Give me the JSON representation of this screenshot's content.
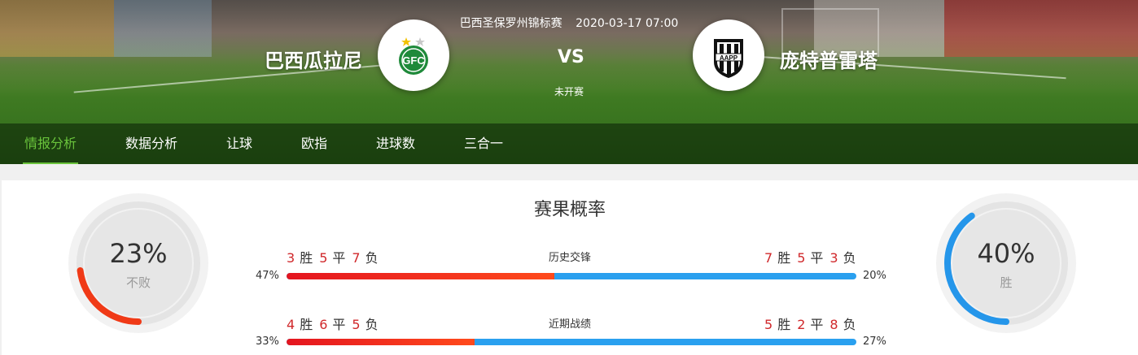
{
  "match": {
    "league": "巴西圣保罗州锦标赛",
    "datetime": "2020-03-17 07:00",
    "home": "巴西瓜拉尼",
    "away": "庞特普雷塔",
    "vs": "VS",
    "status": "未开赛"
  },
  "nav": {
    "tabs": [
      {
        "label": "情报分析",
        "active": true
      },
      {
        "label": "数据分析",
        "active": false
      },
      {
        "label": "让球",
        "active": false
      },
      {
        "label": "欧指",
        "active": false
      },
      {
        "label": "进球数",
        "active": false
      },
      {
        "label": "三合一",
        "active": false
      }
    ]
  },
  "result_prob": {
    "title": "赛果概率",
    "left": {
      "value": "23%",
      "label": "不败",
      "fraction": 0.23,
      "color": "#f03a17"
    },
    "right": {
      "value": "40%",
      "label": "胜",
      "fraction": 0.4,
      "color": "#2596ea"
    },
    "win_word": "胜",
    "draw_word": "平",
    "loss_word": "负",
    "rows": [
      {
        "label": "历史交锋",
        "home": {
          "w": "3",
          "d": "5",
          "l": "7"
        },
        "away": {
          "w": "7",
          "d": "5",
          "l": "3"
        },
        "home_pct": "47%",
        "away_pct": "20%",
        "fill": 0.47
      },
      {
        "label": "近期战绩",
        "home": {
          "w": "4",
          "d": "6",
          "l": "5"
        },
        "away": {
          "w": "5",
          "d": "2",
          "l": "8"
        },
        "home_pct": "33%",
        "away_pct": "27%",
        "fill": 0.33
      }
    ]
  },
  "colors": {
    "accent_green": "#6ac43c",
    "red": "#e4151f",
    "blue": "#2aa0ef"
  }
}
